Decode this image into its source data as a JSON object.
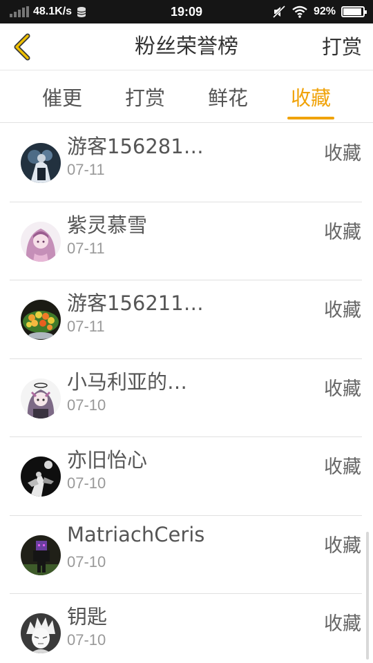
{
  "status_bar": {
    "net_speed": "48.1K/s",
    "time": "19:09",
    "battery_percent": "92%",
    "battery_level": 0.92,
    "icons": [
      "signal-icon",
      "database-icon",
      "mute-icon",
      "wifi-icon",
      "battery-icon"
    ]
  },
  "header": {
    "back_icon": "chevron-left-icon",
    "title": "粉丝荣誉榜",
    "right_link": "打赏"
  },
  "tabs": [
    {
      "label": "催更",
      "active": false
    },
    {
      "label": "打赏",
      "active": false
    },
    {
      "label": "鲜花",
      "active": false
    },
    {
      "label": "收藏",
      "active": true
    }
  ],
  "list": [
    {
      "name": "游客156281…",
      "date": "07-11",
      "action": "收藏"
    },
    {
      "name": "紫灵慕雪",
      "date": "07-11",
      "action": "收藏"
    },
    {
      "name": "游客156211…",
      "date": "07-11",
      "action": "收藏"
    },
    {
      "name": "小马利亚的…",
      "date": "07-10",
      "action": "收藏"
    },
    {
      "name": "亦旧怡心",
      "date": "07-10",
      "action": "收藏"
    },
    {
      "name": "MatriachCeris",
      "date": "07-10",
      "action": "收藏"
    },
    {
      "name": "钥匙",
      "date": "07-10",
      "action": "收藏"
    }
  ],
  "colors": {
    "accent": "#f0a30a",
    "status_bar_bg": "#151515",
    "divider": "#e0e0e0"
  }
}
